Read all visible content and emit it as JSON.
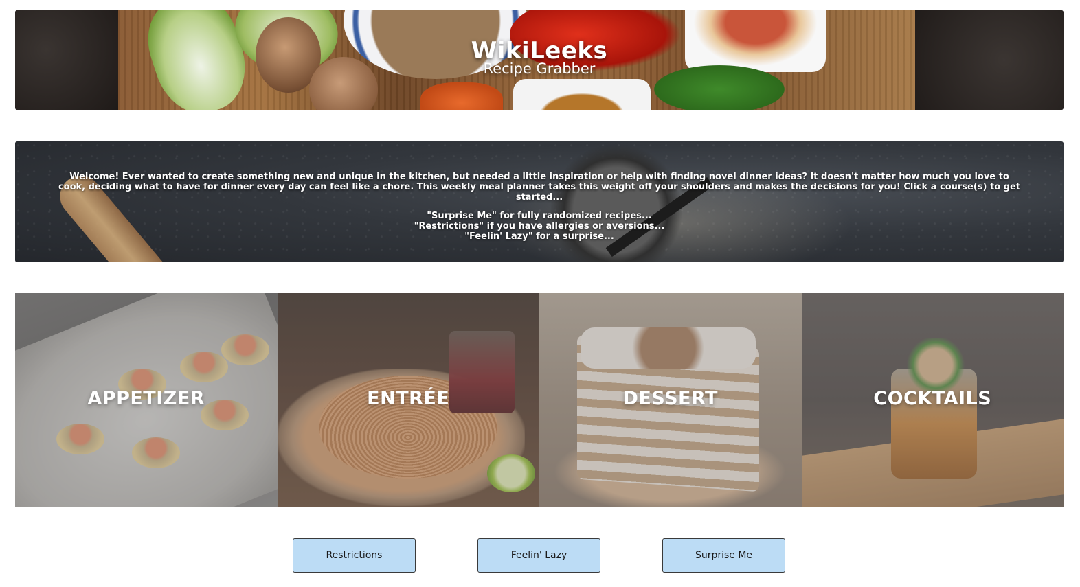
{
  "header": {
    "title": "WikiLeeks",
    "subtitle": "Recipe Grabber"
  },
  "welcome": {
    "intro": "Welcome! Ever wanted to create something new and unique in the kitchen, but needed a little inspiration or help with finding novel dinner ideas? It doesn't matter how much you love to cook, deciding what to have for dinner every day can feel like a chore. This weekly meal planner takes this weight off your shoulders and makes the decisions for you! Click a course(s) to get started...",
    "hints": [
      "\"Surprise Me\" for fully randomized recipes...",
      "\"Restrictions\" if you have allergies or aversions...",
      "\"Feelin' Lazy\" for a surprise..."
    ]
  },
  "courses": [
    {
      "label": "APPETIZER"
    },
    {
      "label": "ENTRÉE"
    },
    {
      "label": "DESSERT"
    },
    {
      "label": "COCKTAILS"
    }
  ],
  "buttons": {
    "restrictions": "Restrictions",
    "lazy": "Feelin' Lazy",
    "surprise": "Surprise Me"
  },
  "colors": {
    "button_bg": "#bcdcf5",
    "text_on_image": "#ffffff"
  }
}
